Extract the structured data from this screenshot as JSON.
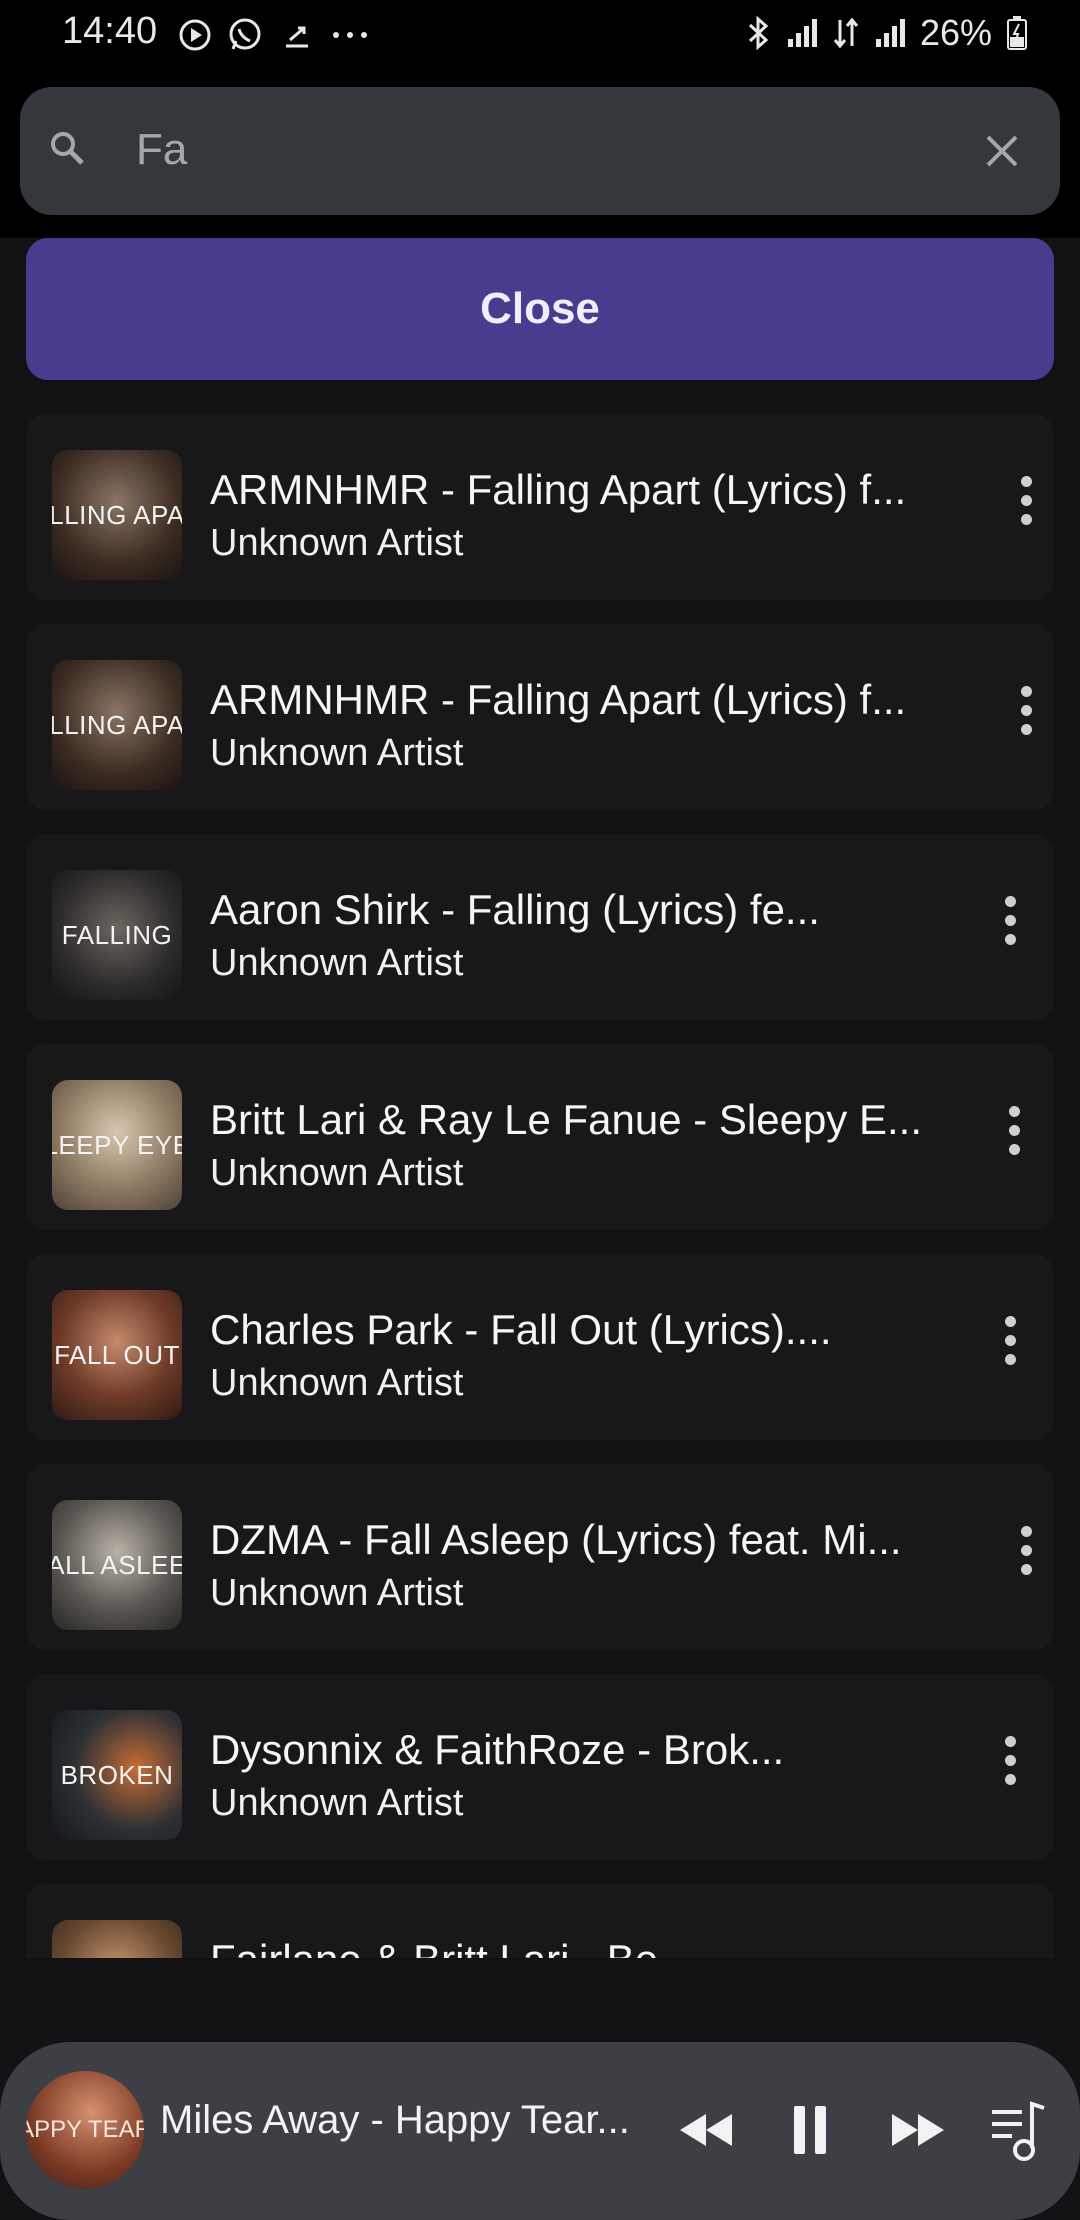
{
  "status_bar": {
    "time": "14:40",
    "battery": "26%"
  },
  "search": {
    "query": "Fa",
    "icon": "search-icon",
    "clear_icon": "close-icon"
  },
  "close_button": {
    "label": "Close",
    "color": "#4b3b8f"
  },
  "songs": [
    {
      "title": "ARMNHMR - Falling Apart (Lyrics) f...",
      "artist": "Unknown Artist",
      "thumb_text": "LLING APA"
    },
    {
      "title": "ARMNHMR - Falling Apart (Lyrics) f...",
      "artist": "Unknown Artist",
      "thumb_text": "LLING APA"
    },
    {
      "title": "Aaron Shirk - Falling (Lyrics) fe...",
      "artist": "Unknown Artist",
      "thumb_text": "FALLING"
    },
    {
      "title": "Britt Lari & Ray Le Fanue - Sleepy E...",
      "artist": "Unknown Artist",
      "thumb_text": "LEEPY EYE"
    },
    {
      "title": "Charles Park - Fall Out (Lyrics)....",
      "artist": "Unknown Artist",
      "thumb_text": "FALL OUT"
    },
    {
      "title": "DZMA - Fall Asleep (Lyrics) feat. Mi...",
      "artist": "Unknown Artist",
      "thumb_text": "ALL ASLEE"
    },
    {
      "title": "Dysonnix & FaithRoze - Brok...",
      "artist": "Unknown Artist",
      "thumb_text": "BROKEN"
    },
    {
      "title": "Fairlane & Britt Lari - Be",
      "artist": "",
      "thumb_text": ""
    }
  ],
  "now_playing": {
    "title": "Miles Away - Happy Tear...",
    "thumb_text": "APPY TEAR"
  }
}
